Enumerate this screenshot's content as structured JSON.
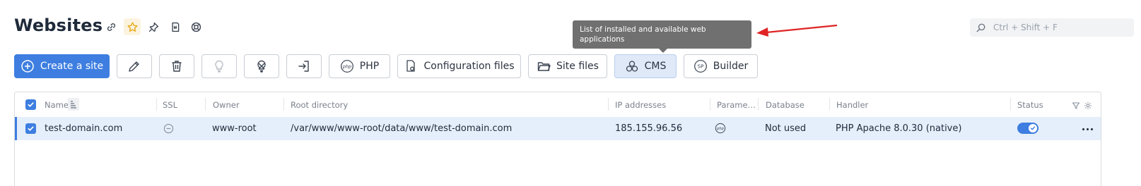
{
  "page": {
    "title": "Websites",
    "title_icons": [
      "link-icon",
      "star-icon",
      "pin-icon",
      "bookmark-icon",
      "help-circle-icon"
    ]
  },
  "search": {
    "placeholder": "Ctrl + Shift + F"
  },
  "tooltip": {
    "text": "List of installed and available web applications"
  },
  "toolbar": {
    "create_label": "Create a site",
    "php_label": "PHP",
    "config_label": "Configuration files",
    "site_files_label": "Site files",
    "cms_label": "CMS",
    "builder_label": "Builder"
  },
  "table": {
    "columns": {
      "name": "Name",
      "ssl": "SSL",
      "owner": "Owner",
      "root": "Root directory",
      "ip": "IP addresses",
      "params": "Parame…",
      "database": "Database",
      "handler": "Handler",
      "status": "Status"
    },
    "rows": [
      {
        "name": "test-domain.com",
        "ssl": "none",
        "owner": "www-root",
        "root": "/var/www/www-root/data/www/test-domain.com",
        "ip": "185.155.96.56",
        "params": "php",
        "database": "Not used",
        "handler": "PHP Apache 8.0.30 (native)",
        "status": "on",
        "selected": true
      }
    ]
  },
  "colors": {
    "accent": "#3d7ee0",
    "selected_row": "#e5eefb",
    "tooltip_bg": "#707070",
    "annotation_arrow": "#e02424"
  }
}
